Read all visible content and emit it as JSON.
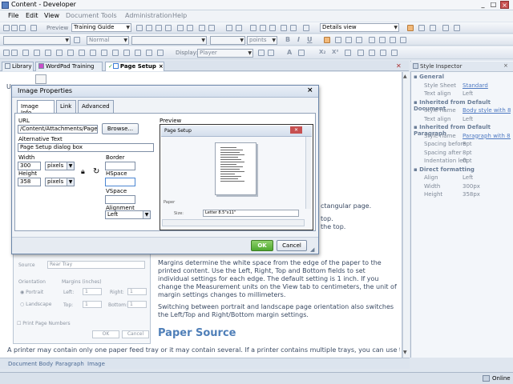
{
  "window": {
    "title": "Content - Developer",
    "minimize": "_",
    "maximize": "□",
    "close": "×"
  },
  "menu": [
    "File",
    "Edit",
    "View",
    "Document",
    "Tools",
    "Administration",
    "Help"
  ],
  "toolbar1": {
    "preview_label": "Preview",
    "guide_value": "Training Guide",
    "view_value": "Details view"
  },
  "toolbar2": {
    "style_value": "Normal",
    "units_value": "points"
  },
  "toolbar3": {
    "display_label": "Display:",
    "display_value": "Player"
  },
  "tabs": [
    "Library",
    "WordPad Training",
    "Page Setup"
  ],
  "document": {
    "p1_frag1": "ctangular page.",
    "p1_frag2": "top.",
    "p1_frag3": "the top.",
    "p2": "Margins determine the white space from the edge of the paper to the printed content. Use the Left, Right, Top and Bottom fields to set individual settings for each edge. The default setting is 1 inch. If you change the Measurement units on the View tab to centimeters, the unit of margin settings changes to millimeters.",
    "p3": "Switching between portrait and landscape page orientation also switches the Left/Top and Right/Bottom margin settings.",
    "heading": "Paper Source",
    "p4": "A printer may contain only one paper feed tray or it may contain several. If a printer contains multiple trays, you can use the Paper"
  },
  "bg_dialog": {
    "source_label": "Source",
    "source_value": "Rear Tray",
    "orientation_label": "Orientation",
    "portrait": "Portrait",
    "landscape": "Landscape",
    "margins_label": "Margins (inches)",
    "left": "Left:",
    "left_val": "1",
    "right": "Right:",
    "right_val": "1",
    "top": "Top:",
    "top_val": "1",
    "bottom": "Bottom:",
    "bottom_val": "1",
    "print_numbers": "Print Page Numbers",
    "ok": "OK",
    "cancel": "Cancel"
  },
  "breadcrumbs": [
    "Document Body",
    "Paragraph",
    "Image"
  ],
  "status": {
    "online": "Online"
  },
  "inspector": {
    "title": "Style Inspector",
    "sections": [
      {
        "title": "General",
        "rows": [
          {
            "k": "Style Sheet",
            "v": "Standard",
            "link": true
          },
          {
            "k": "Text align",
            "v": "Left",
            "link": false
          }
        ]
      },
      {
        "title": "Inherited from Default Document",
        "rows": [
          {
            "k": "Style name",
            "v": "Body style with 8...",
            "link": true
          },
          {
            "k": "Text align",
            "v": "Left",
            "link": false
          }
        ]
      },
      {
        "title": "Inherited from Default Paragraph",
        "rows": [
          {
            "k": "Style name",
            "v": "Paragraph with 8...",
            "link": true
          },
          {
            "k": "Spacing before",
            "v": "8pt",
            "link": false
          },
          {
            "k": "Spacing after",
            "v": "8pt",
            "link": false
          },
          {
            "k": "Indentation left",
            "v": "0pt",
            "link": false
          }
        ]
      },
      {
        "title": "Direct formatting",
        "rows": [
          {
            "k": "Align",
            "v": "Left",
            "link": false
          },
          {
            "k": "Width",
            "v": "300px",
            "link": false
          },
          {
            "k": "Height",
            "v": "358px",
            "link": false
          }
        ]
      }
    ]
  },
  "dialog": {
    "title": "Image Properties",
    "close": "×",
    "tabs": [
      "Image Info",
      "Link",
      "Advanced"
    ],
    "url_label": "URL",
    "url_value": "/Content/Attachments/Page S",
    "browse": "Browse...",
    "alt_label": "Alternative Text",
    "alt_value": "Page Setup dialog box",
    "width_label": "Width",
    "width_value": "300",
    "width_unit": "pixels",
    "height_label": "Height",
    "height_value": "358",
    "height_unit": "pixels",
    "border_label": "Border",
    "border_value": "",
    "hspace_label": "HSpace",
    "hspace_value": "",
    "vspace_label": "VSpace",
    "vspace_value": "",
    "alignment_label": "Alignment",
    "alignment_value": "Left",
    "preview_label": "Preview",
    "preview_dialog_title": "Page Setup",
    "preview_paper": "Paper",
    "preview_size_label": "Size:",
    "preview_size_value": "Letter 8.5\"x11\"",
    "ok": "OK",
    "cancel": "Cancel"
  },
  "colors": {
    "accent": "#4f7fb8",
    "ok_green": "#4ea82f",
    "close_red": "#c75050"
  }
}
